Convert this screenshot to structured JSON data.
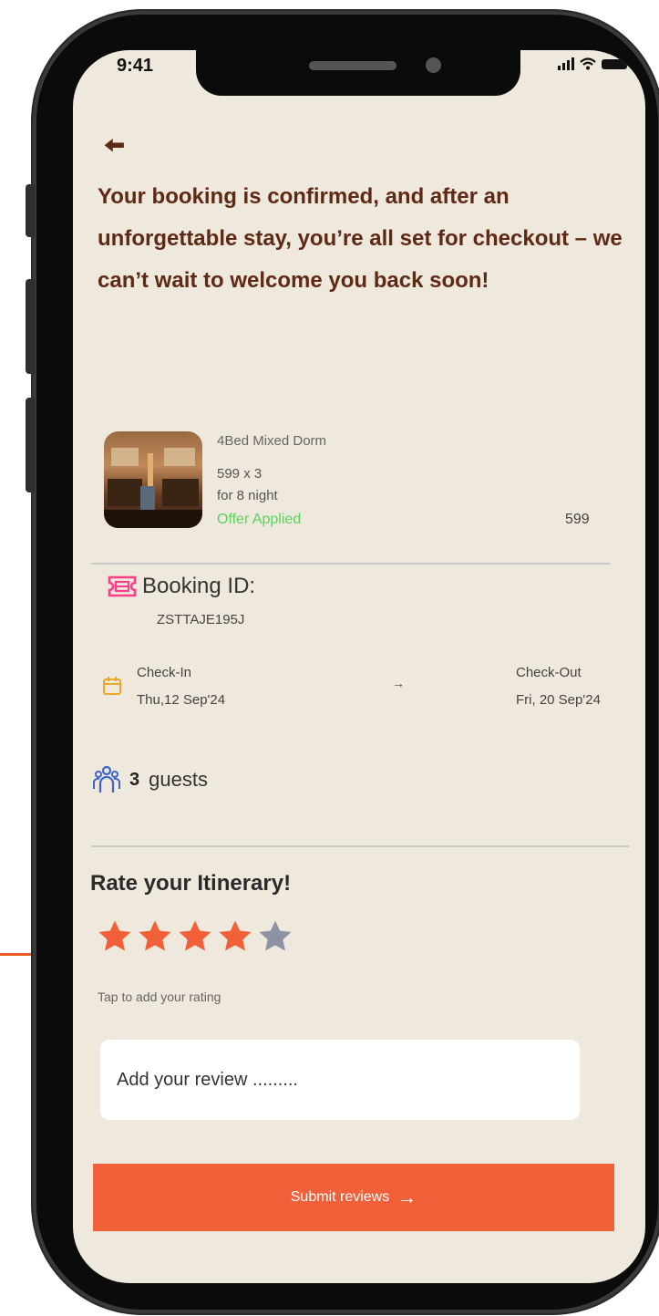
{
  "status_bar": {
    "time": "9:41"
  },
  "headline": "Your booking is confirmed, and after an unforgettable stay, you’re all set for checkout – we can’t wait to welcome you back soon!",
  "room": {
    "name": "4Bed Mixed Dorm",
    "price_line": "599 x 3",
    "nights": "for 8 night",
    "offer": "Offer Applied",
    "total": "599"
  },
  "booking": {
    "label": "Booking ID:",
    "id": "ZSTTAJE195J"
  },
  "stay": {
    "checkin_label": "Check-In",
    "checkin_date": "Thu,12 Sep'24",
    "arrow": "→",
    "checkout_label": "Check-Out",
    "checkout_date": "Fri, 20 Sep'24"
  },
  "guests": {
    "count": "3",
    "label": "guests"
  },
  "rating": {
    "title": "Rate your Itinerary!",
    "value": 4,
    "max": 5,
    "hint": "Tap to add your rating",
    "filled_color": "#f2603a",
    "empty_color": "#8d93a4"
  },
  "review": {
    "placeholder": "Add your review ........."
  },
  "submit": {
    "label": "Submit reviews",
    "arrow": "→"
  },
  "colors": {
    "background": "#efe8dc",
    "accent": "#f2603a",
    "headline": "#5e2a16",
    "offer": "#5cd25c"
  }
}
